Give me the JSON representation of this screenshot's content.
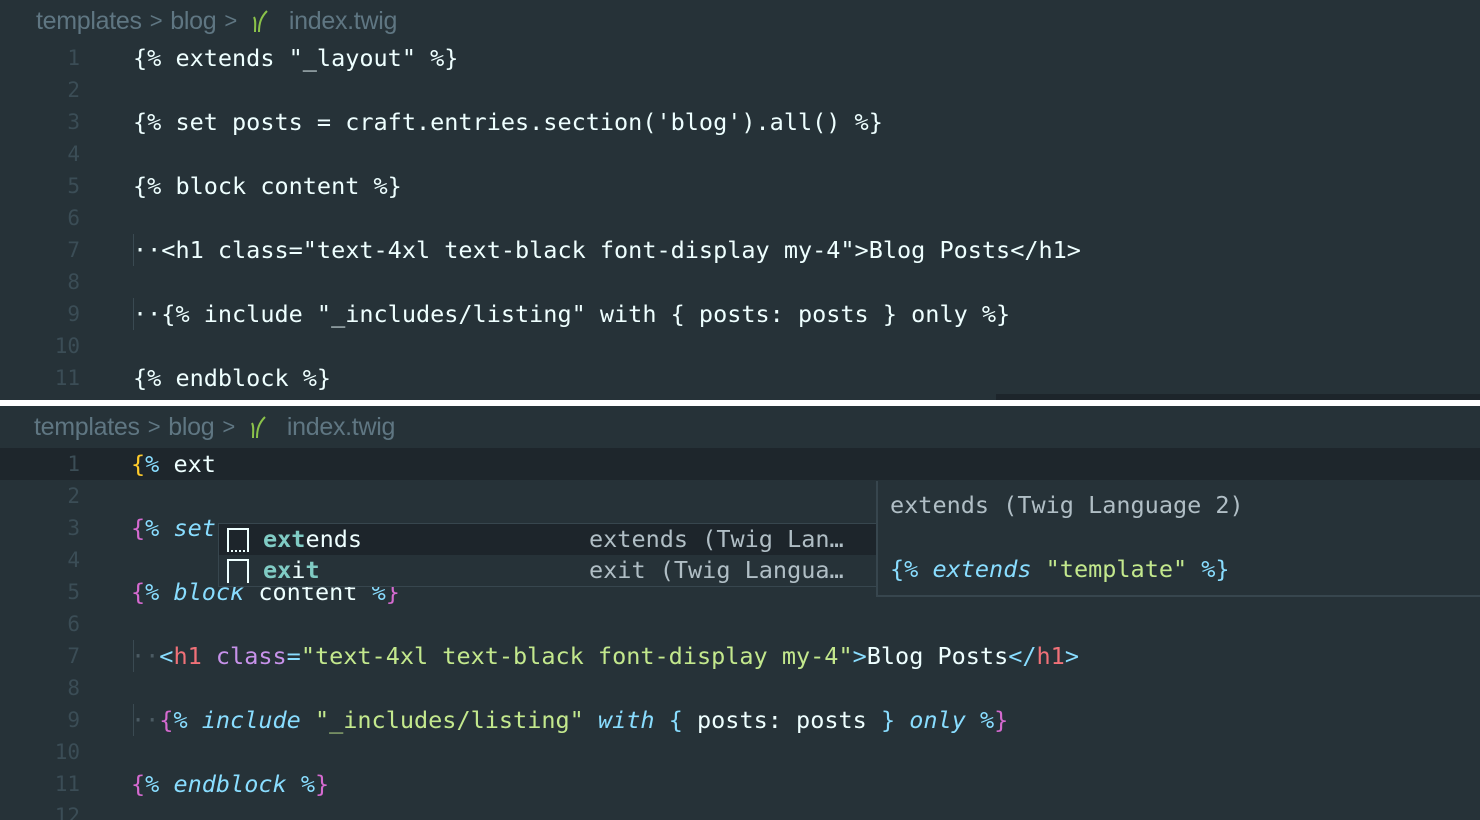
{
  "breadcrumb": [
    "templates",
    "blog",
    "index.twig"
  ],
  "colors": {
    "background": "#263238",
    "keyword": "#89ddff",
    "brace": "#d56ad0",
    "string": "#c3e88d",
    "tag": "#f07178",
    "attribute": "#c792ea",
    "match": "#80cbc4"
  },
  "top_editor": {
    "lines": [
      [
        [
          "plain",
          "{% extends \"_layout\" %}"
        ]
      ],
      [],
      [
        [
          "plain",
          "{% set posts = craft.entries.section('blog').all() %}"
        ]
      ],
      [],
      [
        [
          "plain",
          "{% block content %}"
        ]
      ],
      [],
      [
        [
          "dot",
          "··"
        ],
        [
          "plain",
          "<h1 class=\"text-4xl text-black font-display my-4\">Blog Posts</h1>"
        ]
      ],
      [],
      [
        [
          "dot",
          "··"
        ],
        [
          "plain",
          "{% include \"_includes/listing\" with { posts: posts } only %}"
        ]
      ],
      [],
      [
        [
          "plain",
          "{% endblock %}"
        ]
      ]
    ]
  },
  "bottom_editor": {
    "current_line": 1,
    "lines": [
      [
        [
          "brY",
          "{"
        ],
        [
          "pct",
          "%"
        ],
        [
          "plain",
          " ext"
        ]
      ],
      [],
      [
        [
          "br",
          "{"
        ],
        [
          "pct",
          "%"
        ],
        [
          "plain",
          " "
        ],
        [
          "kw",
          "set"
        ]
      ],
      [],
      [
        [
          "br",
          "{"
        ],
        [
          "pct",
          "%"
        ],
        [
          "plain",
          " "
        ],
        [
          "kw",
          "block"
        ],
        [
          "plain",
          " content "
        ],
        [
          "pct",
          "%"
        ],
        [
          "br",
          "}"
        ]
      ],
      [],
      [
        [
          "dot",
          "··"
        ],
        [
          "punc",
          "<"
        ],
        [
          "tag",
          "h1"
        ],
        [
          "plain",
          " "
        ],
        [
          "attr",
          "class"
        ],
        [
          "punc",
          "="
        ],
        [
          "str",
          "\"text-4xl text-black font-display my-4\""
        ],
        [
          "punc",
          ">"
        ],
        [
          "plain",
          "Blog Posts"
        ],
        [
          "punc",
          "</"
        ],
        [
          "tag",
          "h1"
        ],
        [
          "punc",
          ">"
        ]
      ],
      [],
      [
        [
          "dot",
          "··"
        ],
        [
          "br",
          "{"
        ],
        [
          "pct",
          "%"
        ],
        [
          "plain",
          " "
        ],
        [
          "kw",
          "include"
        ],
        [
          "plain",
          " "
        ],
        [
          "str",
          "\"_includes/listing\""
        ],
        [
          "plain",
          " "
        ],
        [
          "kw",
          "with"
        ],
        [
          "plain",
          " "
        ],
        [
          "punc",
          "{"
        ],
        [
          "plain",
          " posts: posts "
        ],
        [
          "punc",
          "}"
        ],
        [
          "plain",
          " "
        ],
        [
          "kw",
          "only"
        ],
        [
          "plain",
          " "
        ],
        [
          "pct",
          "%"
        ],
        [
          "br",
          "}"
        ]
      ],
      [],
      [
        [
          "br",
          "{"
        ],
        [
          "pct",
          "%"
        ],
        [
          "plain",
          " "
        ],
        [
          "kw",
          "endblock"
        ],
        [
          "plain",
          " "
        ],
        [
          "pct",
          "%"
        ],
        [
          "br",
          "}"
        ]
      ],
      []
    ]
  },
  "autocomplete": {
    "items": [
      {
        "match": "ext",
        "rest": "ends",
        "detail": "extends (Twig Lan…",
        "selected": true
      },
      {
        "match": "ex",
        "mid": "i",
        "match2": "t",
        "detail": "exit (Twig Langua…",
        "selected": false
      }
    ],
    "doc_title": "extends (Twig Language 2)",
    "doc_snippet": [
      [
        "punc",
        "{% "
      ],
      [
        "kw",
        "extends"
      ],
      [
        "plain",
        " "
      ],
      [
        "str",
        "\"template\""
      ],
      [
        "punc",
        " %}"
      ]
    ]
  }
}
